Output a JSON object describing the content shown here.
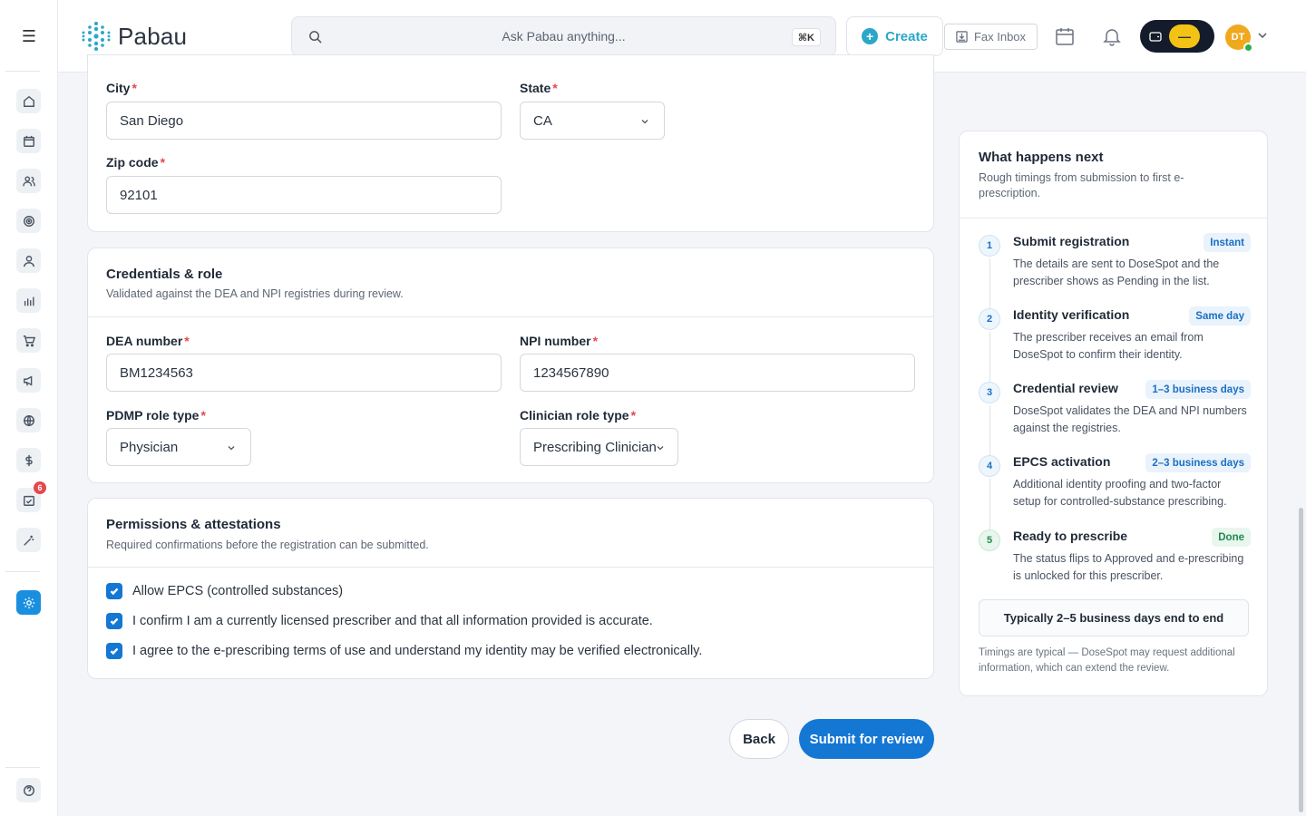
{
  "app": {
    "brand": "Pabau"
  },
  "topbar": {
    "search_placeholder": "Ask Pabau anything...",
    "search_shortcut": "⌘K",
    "create_label": "Create",
    "fax_label": "Fax Inbox",
    "avatar_initials": "DT"
  },
  "sidebar": {
    "notification_count": "6"
  },
  "address": {
    "city_label": "City",
    "city_value": "San Diego",
    "state_label": "State",
    "state_value": "CA",
    "zip_label": "Zip code",
    "zip_value": "92101"
  },
  "credentials": {
    "title": "Credentials & role",
    "subtitle": "Validated against the DEA and NPI registries during review.",
    "dea_label": "DEA number",
    "dea_value": "BM1234563",
    "npi_label": "NPI number",
    "npi_value": "1234567890",
    "pdmp_label": "PDMP role type",
    "pdmp_value": "Physician",
    "clinician_label": "Clinician role type",
    "clinician_value": "Prescribing Clinician"
  },
  "permissions": {
    "title": "Permissions & attestations",
    "subtitle": "Required confirmations before the registration can be submitted.",
    "items": [
      {
        "label": "Allow EPCS (controlled substances)",
        "checked": true
      },
      {
        "label": "I confirm I am a currently licensed prescriber and that all information provided is accurate.",
        "checked": true
      },
      {
        "label": "I agree to the e-prescribing terms of use and understand my identity may be verified electronically.",
        "checked": true
      }
    ]
  },
  "actions": {
    "back_label": "Back",
    "submit_label": "Submit for review"
  },
  "next_panel": {
    "title": "What happens next",
    "subtitle": "Rough timings from submission to first e-prescription.",
    "steps": [
      {
        "num": "1",
        "title": "Submit registration",
        "tag": "Instant",
        "desc": "The details are sent to DoseSpot and the prescriber shows as Pending in the list."
      },
      {
        "num": "2",
        "title": "Identity verification",
        "tag": "Same day",
        "desc": "The prescriber receives an email from DoseSpot to confirm their identity."
      },
      {
        "num": "3",
        "title": "Credential review",
        "tag": "1–3 business days",
        "desc": "DoseSpot validates the DEA and NPI numbers against the registries."
      },
      {
        "num": "4",
        "title": "EPCS activation",
        "tag": "2–3 business days",
        "desc": "Additional identity proofing and two-factor setup for controlled-substance prescribing."
      },
      {
        "num": "5",
        "title": "Ready to prescribe",
        "tag": "Done",
        "desc": "The status flips to Approved and e-prescribing is unlocked for this prescriber."
      }
    ],
    "summary": "Typically 2–5 business days end to end",
    "footnote": "Timings are typical — DoseSpot may request additional information, which can extend the review."
  },
  "colors": {
    "primary": "#1477d4",
    "brand": "#2aa7c9",
    "required": "#e5484d",
    "done": "#1f8a4c"
  }
}
